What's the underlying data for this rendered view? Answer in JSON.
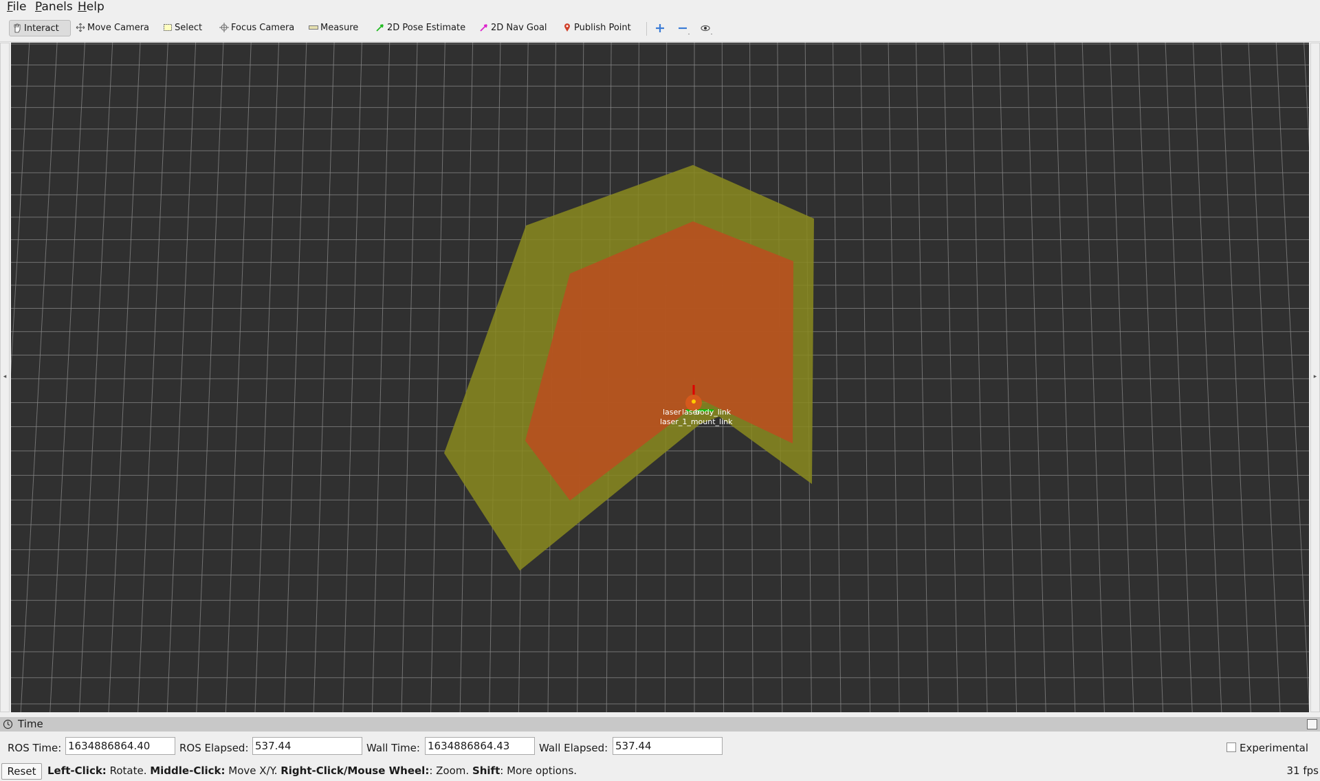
{
  "menu": [
    "File",
    "Panels",
    "Help"
  ],
  "toolbar": {
    "interact": "Interact",
    "move_camera": "Move Camera",
    "select": "Select",
    "focus_camera": "Focus Camera",
    "measure": "Measure",
    "pose_estimate": "2D Pose Estimate",
    "nav_goal": "2D Nav Goal",
    "publish_point": "Publish Point",
    "icons": [
      "plus-icon",
      "minus-icon",
      "eye-icon"
    ]
  },
  "viewport": {
    "background": "#303030",
    "grid_color": "#8a8a8a",
    "outer_polygon_color": "#8a8a1f",
    "inner_polygon_color": "#b8501f",
    "frame_labels": [
      "laser",
      "laser",
      "body_link",
      "laser_1_mount_link"
    ]
  },
  "time_panel": {
    "title": "Time",
    "ros_time_label": "ROS Time:",
    "ros_time": "1634886864.40",
    "ros_elapsed_label": "ROS Elapsed:",
    "ros_elapsed": "537.44",
    "wall_time_label": "Wall Time:",
    "wall_time": "1634886864.43",
    "wall_elapsed_label": "Wall Elapsed:",
    "wall_elapsed": "537.44",
    "experimental": "Experimental"
  },
  "status": {
    "reset": "Reset",
    "left_click": "Left-Click:",
    "left_click_action": " Rotate. ",
    "middle_click": "Middle-Click:",
    "middle_click_action": " Move X/Y. ",
    "right_click": "Right-Click/Mouse Wheel:",
    "right_click_action": ": Zoom. ",
    "shift": "Shift",
    "shift_action": ": More options.",
    "fps": "31 fps"
  }
}
